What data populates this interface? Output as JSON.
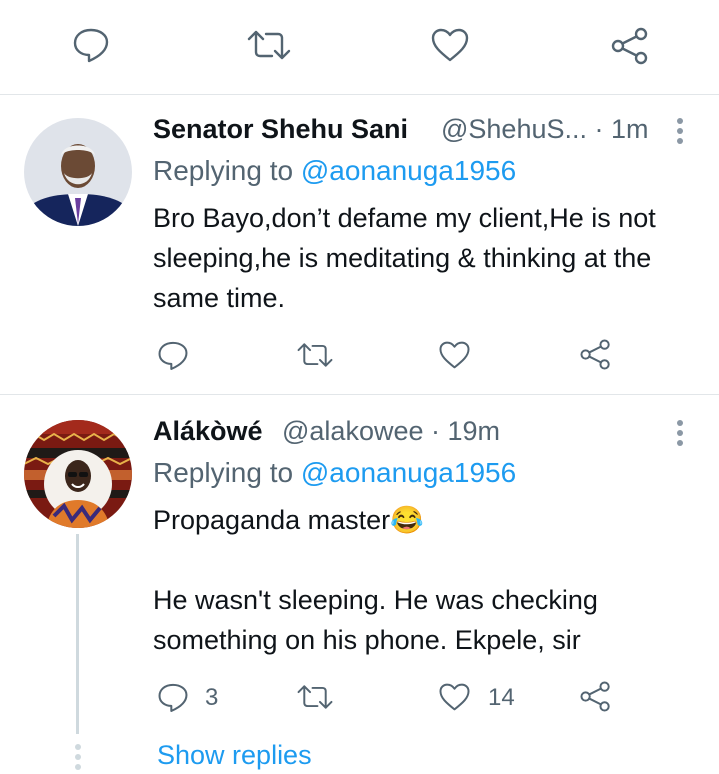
{
  "top_actions": {
    "reply": "reply-icon",
    "retweet": "retweet-icon",
    "like": "heart-icon",
    "share": "share-icon"
  },
  "tweets": [
    {
      "display_name": "Senator Shehu Sani",
      "handle_time": "@ShehuS... · 1m",
      "replying_prefix": "Replying to",
      "replying_handle": "@aonanuga1956",
      "text": "Bro Bayo,don’t defame my client,He is not sleeping,he is meditating & thinking at the same time.",
      "reply_count": "",
      "like_count": ""
    },
    {
      "display_name": "Alákòwé",
      "handle_time": "@alakowee · 19m",
      "replying_prefix": "Replying to",
      "replying_handle": "@aonanuga1956",
      "text_line1": "Propaganda master😂",
      "text_line2": "He wasn't sleeping. He was checking something on his phone. Ekpele, sir",
      "reply_count": "3",
      "like_count": "14"
    }
  ],
  "show_replies": "Show replies",
  "colors": {
    "accent": "#1d9bf0",
    "muted": "#536471",
    "text": "#0f1419"
  }
}
